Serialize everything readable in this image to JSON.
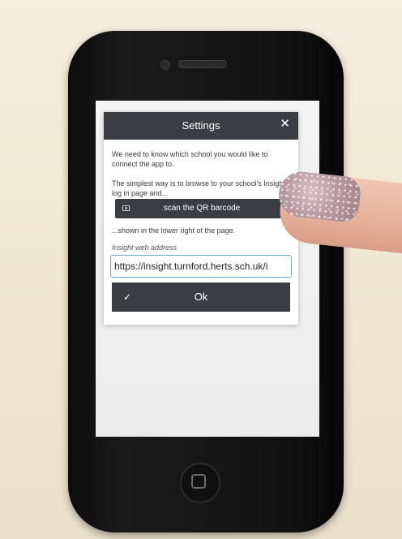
{
  "dialog": {
    "title": "Settings",
    "close_glyph": "✕",
    "intro_text": "We need to know which school you would like to connect the app to.",
    "browse_text": "The simplest way is to browse to your school's Insight log in page and...",
    "scan_label": "scan the QR barcode",
    "lower_right_text": "...shown in the lower right of the page.",
    "address_label": "Insight web address",
    "address_value": "https://insight.turnford.herts.sch.uk/i",
    "ok_label": "Ok",
    "check_glyph": "✓"
  },
  "colors": {
    "header_bg": "#3a3d42",
    "input_border": "#79a6d6"
  },
  "icons": {
    "close": "close-icon",
    "camera": "camera-icon",
    "check": "check-icon"
  }
}
